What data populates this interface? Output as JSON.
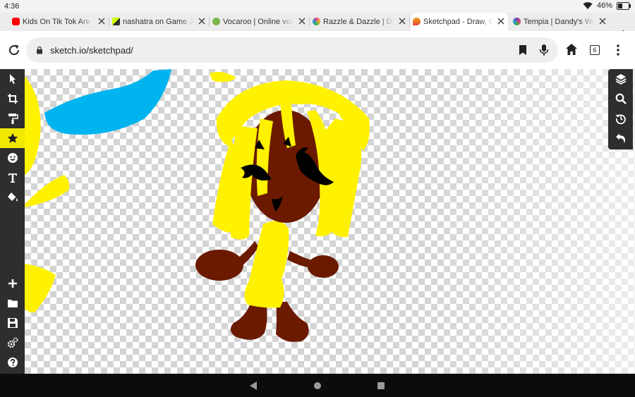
{
  "status_bar": {
    "time": "4:36",
    "battery_text": "46%",
    "battery_level": 0.46
  },
  "tabs": [
    {
      "label": "Kids On Tik Tok Are F",
      "favicon": "youtube-icon",
      "color": "#ff0000"
    },
    {
      "label": "nashatra on Game Jol",
      "favicon": "gamejolt-icon",
      "color": "#2f7f6f"
    },
    {
      "label": "Vocaroo | Online voice",
      "favicon": "vocaroo-icon",
      "color": "#7ab648"
    },
    {
      "label": "Razzle & Dazzle | Dand",
      "favicon": "fandom-icon",
      "color": "#e5427a"
    },
    {
      "label": "Sketchpad - Draw, Cre",
      "favicon": "sketchpad-icon",
      "color": "#f39c12",
      "active": true
    },
    {
      "label": "Tempia | Dandy's Worl",
      "favicon": "fandom-icon",
      "color": "#7b3fb3"
    }
  ],
  "address_bar": {
    "url": "sketch.io/sketchpad/",
    "tab_count": "6"
  },
  "left_tools": [
    {
      "name": "select-tool",
      "icon": "pointer-icon"
    },
    {
      "name": "crop-tool",
      "icon": "crop-icon"
    },
    {
      "name": "brush-tool",
      "icon": "paint-roller-icon"
    },
    {
      "name": "stamp-tool",
      "icon": "star-icon",
      "active": true
    },
    {
      "name": "emoji-tool",
      "icon": "smiley-icon"
    },
    {
      "name": "text-tool",
      "icon": "text-icon"
    },
    {
      "name": "fill-tool",
      "icon": "paint-bucket-icon"
    },
    {
      "name": "new-button",
      "icon": "plus-icon"
    },
    {
      "name": "open-button",
      "icon": "folder-icon"
    },
    {
      "name": "save-button",
      "icon": "floppy-icon"
    },
    {
      "name": "settings-button",
      "icon": "gears-icon"
    },
    {
      "name": "help-button",
      "icon": "question-icon"
    }
  ],
  "right_tools": [
    {
      "name": "layers-button",
      "icon": "layers-icon"
    },
    {
      "name": "zoom-button",
      "icon": "magnifier-icon"
    },
    {
      "name": "history-button",
      "icon": "history-icon"
    },
    {
      "name": "undo-button",
      "icon": "undo-icon"
    }
  ],
  "colors": {
    "toolbar_dark": "#2e2e2e",
    "active_tool": "#f0e800",
    "hair_yellow": "#fff200",
    "skin_brown": "#6b1a00",
    "blue_stroke": "#00b4f0"
  }
}
